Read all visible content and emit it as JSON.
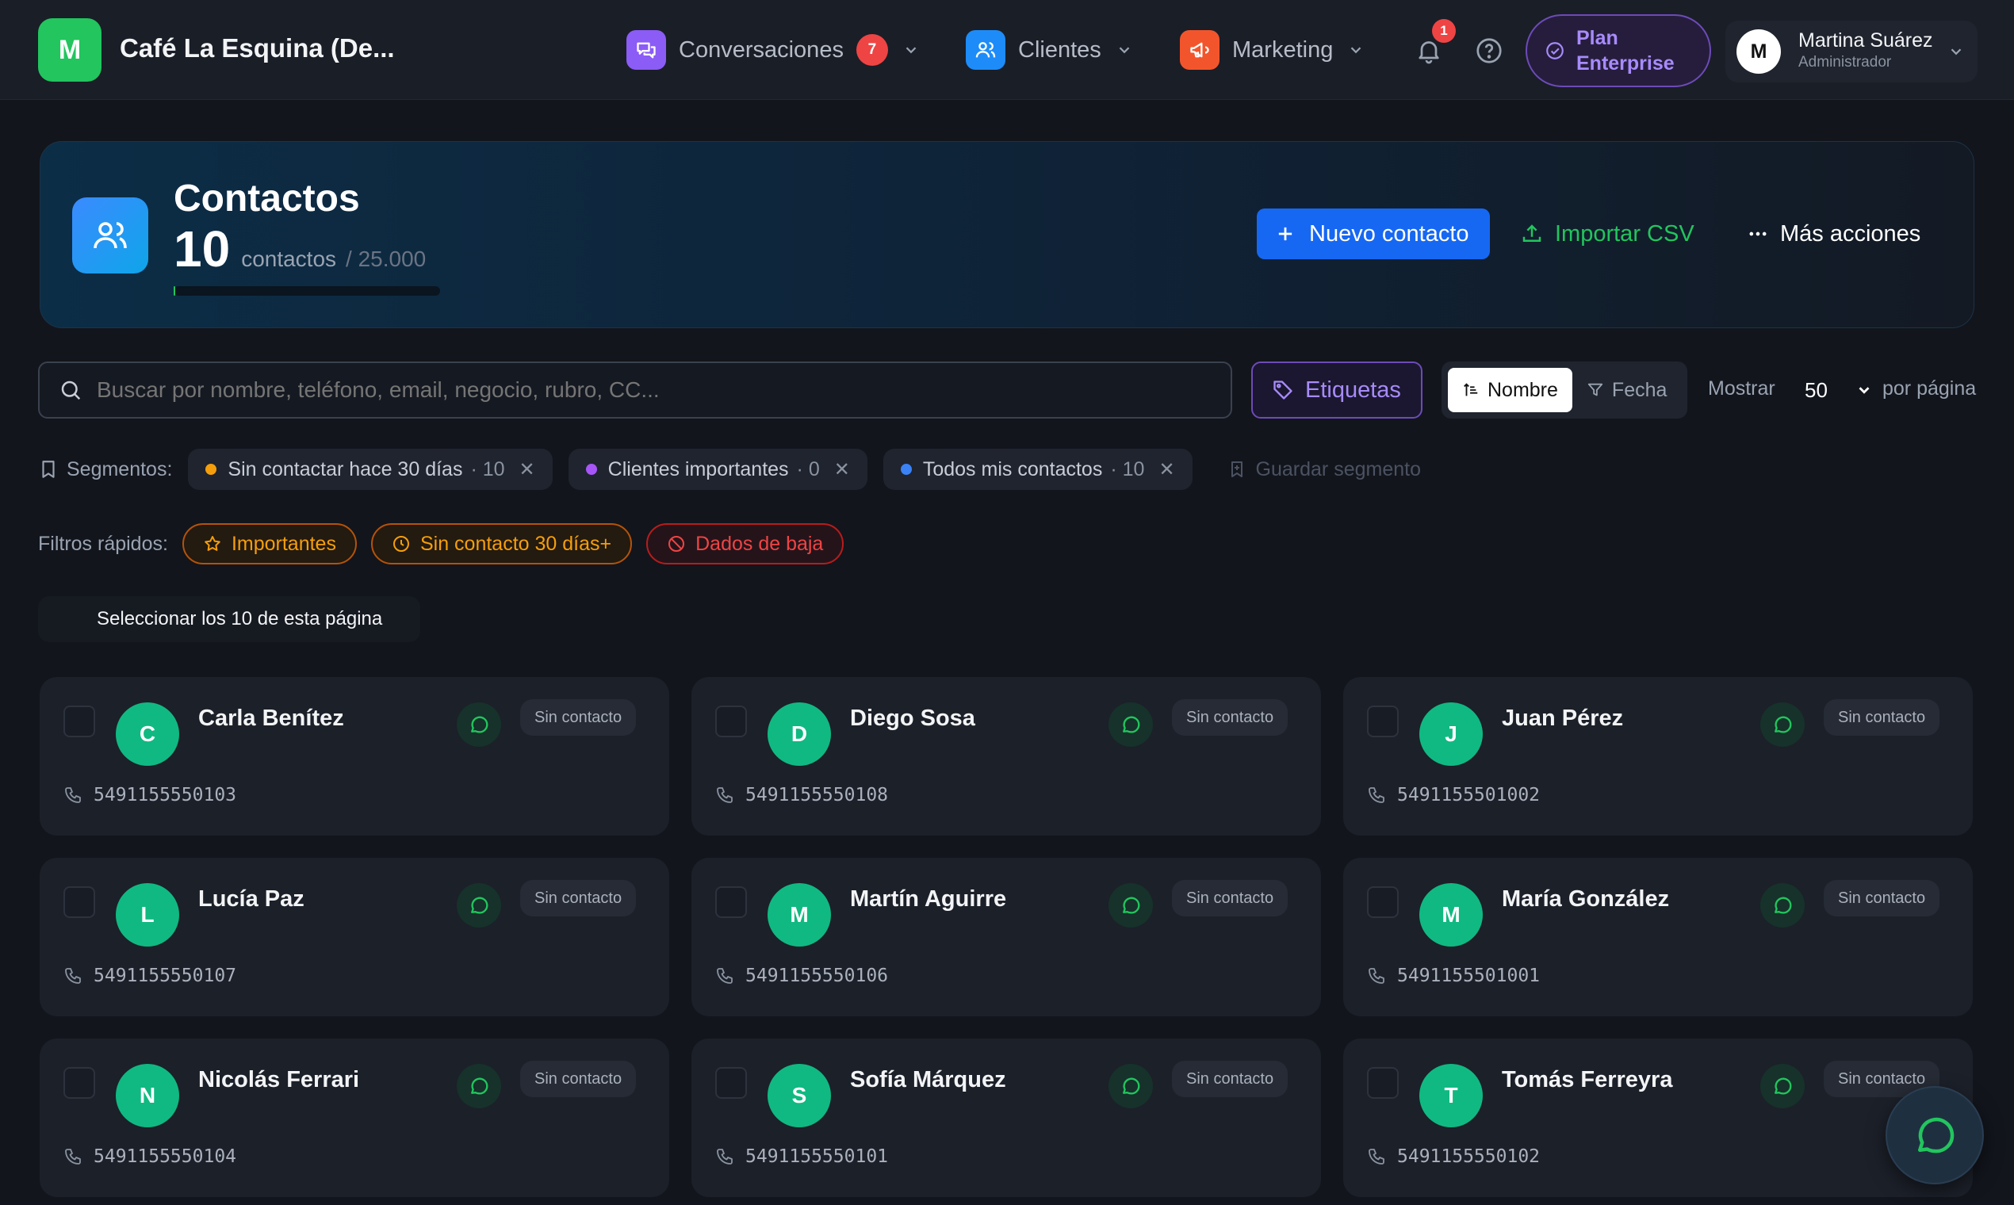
{
  "brand": {
    "initial": "M",
    "name": "Café La Esquina (De..."
  },
  "nav": {
    "conversations": {
      "label": "Conversaciones",
      "badge": "7"
    },
    "clients": {
      "label": "Clientes"
    },
    "marketing": {
      "label": "Marketing"
    }
  },
  "notifications": {
    "badge": "1"
  },
  "plan": {
    "line1": "Plan",
    "line2": "Enterprise"
  },
  "user": {
    "initial": "M",
    "name": "Martina Suárez",
    "role": "Administrador"
  },
  "hero": {
    "title": "Contactos",
    "count": "10",
    "count_label": "contactos",
    "limit": "/ 25.000",
    "usage_fraction": 0.0004,
    "new_button": "Nuevo contacto",
    "import_button": "Importar CSV",
    "more_button": "Más acciones"
  },
  "search": {
    "placeholder": "Buscar por nombre, teléfono, email, negocio, rubro, CC..."
  },
  "tags_button": "Etiquetas",
  "sort": {
    "name": "Nombre",
    "date": "Fecha"
  },
  "pagination": {
    "show_label": "Mostrar",
    "page_size": "50",
    "per_page_label": "por página"
  },
  "segments": {
    "label": "Segmentos:",
    "items": [
      {
        "label": "Sin contactar hace 30 días",
        "count": "· 10",
        "color": "#f59e0b"
      },
      {
        "label": "Clientes importantes",
        "count": "· 0",
        "color": "#a855f7"
      },
      {
        "label": "Todos mis contactos",
        "count": "· 10",
        "color": "#3b82f6"
      }
    ],
    "save_label": "Guardar segmento"
  },
  "quick_filters": {
    "label": "Filtros rápidos:",
    "items": [
      {
        "label": "Importantes",
        "color": "#f59e0b"
      },
      {
        "label": "Sin contacto 30 días+",
        "color": "#f59e0b"
      },
      {
        "label": "Dados de baja",
        "color": "#ef4444"
      }
    ]
  },
  "select_all_label": "Seleccionar los 10 de esta página",
  "contacts": [
    {
      "initial": "C",
      "name": "Carla Benítez",
      "status": "Sin contacto",
      "phone": "5491155550103"
    },
    {
      "initial": "D",
      "name": "Diego Sosa",
      "status": "Sin contacto",
      "phone": "5491155550108"
    },
    {
      "initial": "J",
      "name": "Juan Pérez",
      "status": "Sin contacto",
      "phone": "5491155501002"
    },
    {
      "initial": "L",
      "name": "Lucía Paz",
      "status": "Sin contacto",
      "phone": "5491155550107"
    },
    {
      "initial": "M",
      "name": "Martín Aguirre",
      "status": "Sin contacto",
      "phone": "5491155550106"
    },
    {
      "initial": "M",
      "name": "María González",
      "status": "Sin contacto",
      "phone": "5491155501001"
    },
    {
      "initial": "N",
      "name": "Nicolás Ferrari",
      "status": "Sin contacto",
      "phone": "5491155550104"
    },
    {
      "initial": "S",
      "name": "Sofía Márquez",
      "status": "Sin contacto",
      "phone": "5491155550101"
    },
    {
      "initial": "T",
      "name": "Tomás Ferreyra",
      "status": "Sin contacto",
      "phone": "5491155550102"
    }
  ],
  "colors": {
    "accent": "#1668f2",
    "success": "#22c55e",
    "purple": "#a78bfa",
    "danger": "#ef4444",
    "warning": "#f59e0b"
  }
}
